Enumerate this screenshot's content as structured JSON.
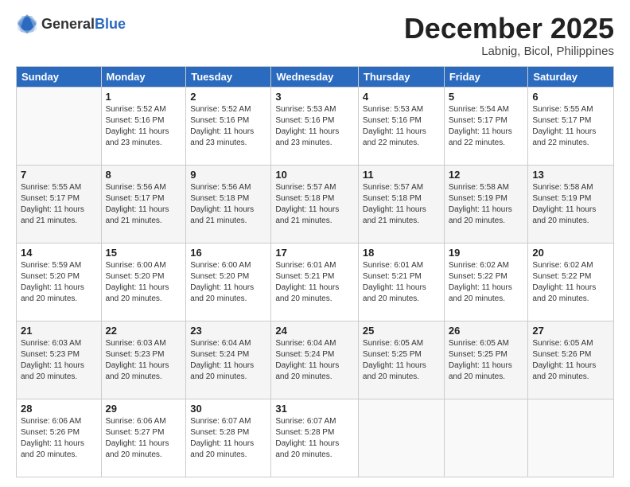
{
  "header": {
    "logo_general": "General",
    "logo_blue": "Blue",
    "month_year": "December 2025",
    "location": "Labnig, Bicol, Philippines"
  },
  "days_of_week": [
    "Sunday",
    "Monday",
    "Tuesday",
    "Wednesday",
    "Thursday",
    "Friday",
    "Saturday"
  ],
  "weeks": [
    [
      {
        "day": "",
        "info": ""
      },
      {
        "day": "1",
        "info": "Sunrise: 5:52 AM\nSunset: 5:16 PM\nDaylight: 11 hours and 23 minutes."
      },
      {
        "day": "2",
        "info": "Sunrise: 5:52 AM\nSunset: 5:16 PM\nDaylight: 11 hours and 23 minutes."
      },
      {
        "day": "3",
        "info": "Sunrise: 5:53 AM\nSunset: 5:16 PM\nDaylight: 11 hours and 23 minutes."
      },
      {
        "day": "4",
        "info": "Sunrise: 5:53 AM\nSunset: 5:16 PM\nDaylight: 11 hours and 22 minutes."
      },
      {
        "day": "5",
        "info": "Sunrise: 5:54 AM\nSunset: 5:17 PM\nDaylight: 11 hours and 22 minutes."
      },
      {
        "day": "6",
        "info": "Sunrise: 5:55 AM\nSunset: 5:17 PM\nDaylight: 11 hours and 22 minutes."
      }
    ],
    [
      {
        "day": "7",
        "info": "Sunrise: 5:55 AM\nSunset: 5:17 PM\nDaylight: 11 hours and 21 minutes."
      },
      {
        "day": "8",
        "info": "Sunrise: 5:56 AM\nSunset: 5:17 PM\nDaylight: 11 hours and 21 minutes."
      },
      {
        "day": "9",
        "info": "Sunrise: 5:56 AM\nSunset: 5:18 PM\nDaylight: 11 hours and 21 minutes."
      },
      {
        "day": "10",
        "info": "Sunrise: 5:57 AM\nSunset: 5:18 PM\nDaylight: 11 hours and 21 minutes."
      },
      {
        "day": "11",
        "info": "Sunrise: 5:57 AM\nSunset: 5:18 PM\nDaylight: 11 hours and 21 minutes."
      },
      {
        "day": "12",
        "info": "Sunrise: 5:58 AM\nSunset: 5:19 PM\nDaylight: 11 hours and 20 minutes."
      },
      {
        "day": "13",
        "info": "Sunrise: 5:58 AM\nSunset: 5:19 PM\nDaylight: 11 hours and 20 minutes."
      }
    ],
    [
      {
        "day": "14",
        "info": "Sunrise: 5:59 AM\nSunset: 5:20 PM\nDaylight: 11 hours and 20 minutes."
      },
      {
        "day": "15",
        "info": "Sunrise: 6:00 AM\nSunset: 5:20 PM\nDaylight: 11 hours and 20 minutes."
      },
      {
        "day": "16",
        "info": "Sunrise: 6:00 AM\nSunset: 5:20 PM\nDaylight: 11 hours and 20 minutes."
      },
      {
        "day": "17",
        "info": "Sunrise: 6:01 AM\nSunset: 5:21 PM\nDaylight: 11 hours and 20 minutes."
      },
      {
        "day": "18",
        "info": "Sunrise: 6:01 AM\nSunset: 5:21 PM\nDaylight: 11 hours and 20 minutes."
      },
      {
        "day": "19",
        "info": "Sunrise: 6:02 AM\nSunset: 5:22 PM\nDaylight: 11 hours and 20 minutes."
      },
      {
        "day": "20",
        "info": "Sunrise: 6:02 AM\nSunset: 5:22 PM\nDaylight: 11 hours and 20 minutes."
      }
    ],
    [
      {
        "day": "21",
        "info": "Sunrise: 6:03 AM\nSunset: 5:23 PM\nDaylight: 11 hours and 20 minutes."
      },
      {
        "day": "22",
        "info": "Sunrise: 6:03 AM\nSunset: 5:23 PM\nDaylight: 11 hours and 20 minutes."
      },
      {
        "day": "23",
        "info": "Sunrise: 6:04 AM\nSunset: 5:24 PM\nDaylight: 11 hours and 20 minutes."
      },
      {
        "day": "24",
        "info": "Sunrise: 6:04 AM\nSunset: 5:24 PM\nDaylight: 11 hours and 20 minutes."
      },
      {
        "day": "25",
        "info": "Sunrise: 6:05 AM\nSunset: 5:25 PM\nDaylight: 11 hours and 20 minutes."
      },
      {
        "day": "26",
        "info": "Sunrise: 6:05 AM\nSunset: 5:25 PM\nDaylight: 11 hours and 20 minutes."
      },
      {
        "day": "27",
        "info": "Sunrise: 6:05 AM\nSunset: 5:26 PM\nDaylight: 11 hours and 20 minutes."
      }
    ],
    [
      {
        "day": "28",
        "info": "Sunrise: 6:06 AM\nSunset: 5:26 PM\nDaylight: 11 hours and 20 minutes."
      },
      {
        "day": "29",
        "info": "Sunrise: 6:06 AM\nSunset: 5:27 PM\nDaylight: 11 hours and 20 minutes."
      },
      {
        "day": "30",
        "info": "Sunrise: 6:07 AM\nSunset: 5:28 PM\nDaylight: 11 hours and 20 minutes."
      },
      {
        "day": "31",
        "info": "Sunrise: 6:07 AM\nSunset: 5:28 PM\nDaylight: 11 hours and 20 minutes."
      },
      {
        "day": "",
        "info": ""
      },
      {
        "day": "",
        "info": ""
      },
      {
        "day": "",
        "info": ""
      }
    ]
  ]
}
